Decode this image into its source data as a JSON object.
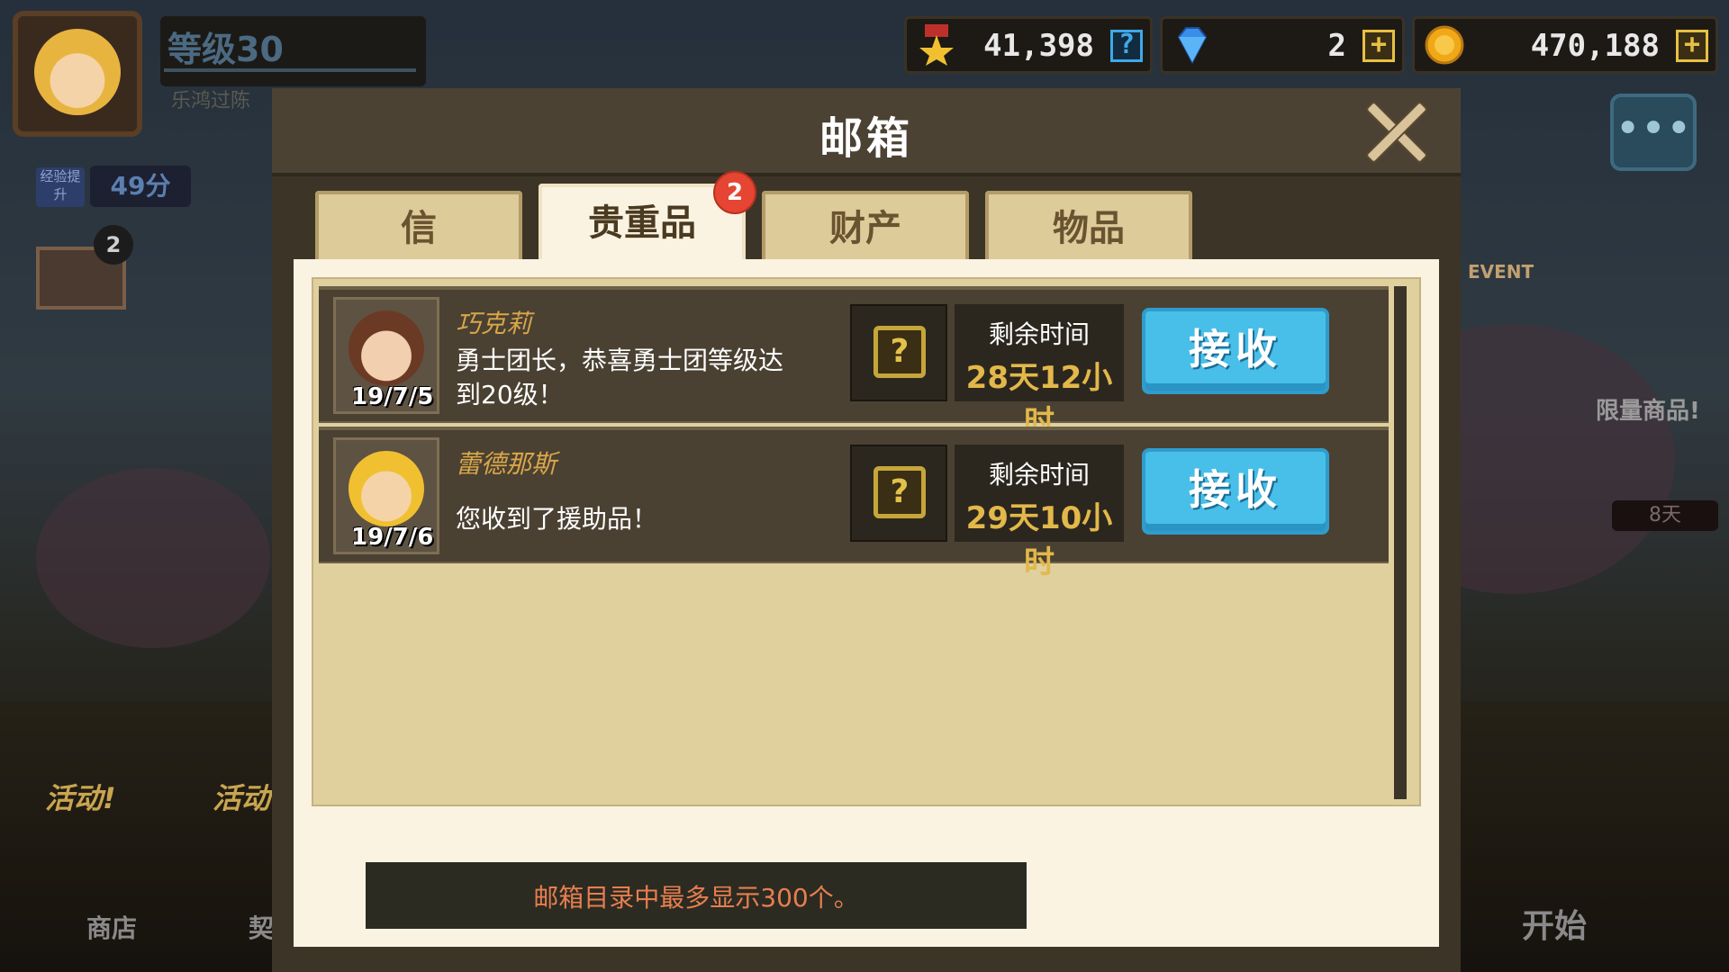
{
  "profile": {
    "level": "等级30",
    "name": "乐鸿过陈",
    "exp_badge": "经验提升",
    "exp_time": "49分",
    "mail_count": "2"
  },
  "currencies": [
    {
      "name": "medal",
      "icon": "medal-icon",
      "value": "41,398",
      "button": "?"
    },
    {
      "name": "gem",
      "icon": "diamond-icon",
      "value": "2",
      "button": "+"
    },
    {
      "name": "gold",
      "icon": "coin-icon",
      "value": "470,188",
      "button": "+"
    }
  ],
  "side": {
    "chat_icon": "•••",
    "event": "EVENT",
    "limited": "限量商品!",
    "days": "8天",
    "shop": "商店",
    "contract": "契约",
    "start": "开始",
    "event_tag": "活动!"
  },
  "mailbox": {
    "title": "邮箱",
    "tabs": [
      {
        "label": "信",
        "active": false
      },
      {
        "label": "贵重品",
        "active": true,
        "badge": "2"
      },
      {
        "label": "财产",
        "active": false
      },
      {
        "label": "物品",
        "active": false
      }
    ],
    "items": [
      {
        "sender": "巧克莉",
        "date": "19/7/5",
        "message": "勇士团长，恭喜勇士团等级达到20级！",
        "time_label": "剩余时间",
        "time_value": "28天12小时",
        "button": "接收",
        "reward_icon": "scroll-icon"
      },
      {
        "sender": "蕾德那斯",
        "date": "19/7/6",
        "message": "您收到了援助品！",
        "time_label": "剩余时间",
        "time_value": "29天10小时",
        "button": "接收",
        "reward_icon": "scroll-icon"
      }
    ],
    "notice": "邮箱目录中最多显示300个。"
  },
  "colors": {
    "accent_blue": "#48bfe8",
    "gold_text": "#e3b84a",
    "badge_red": "#e54532",
    "notice_text": "#e87e4f"
  }
}
